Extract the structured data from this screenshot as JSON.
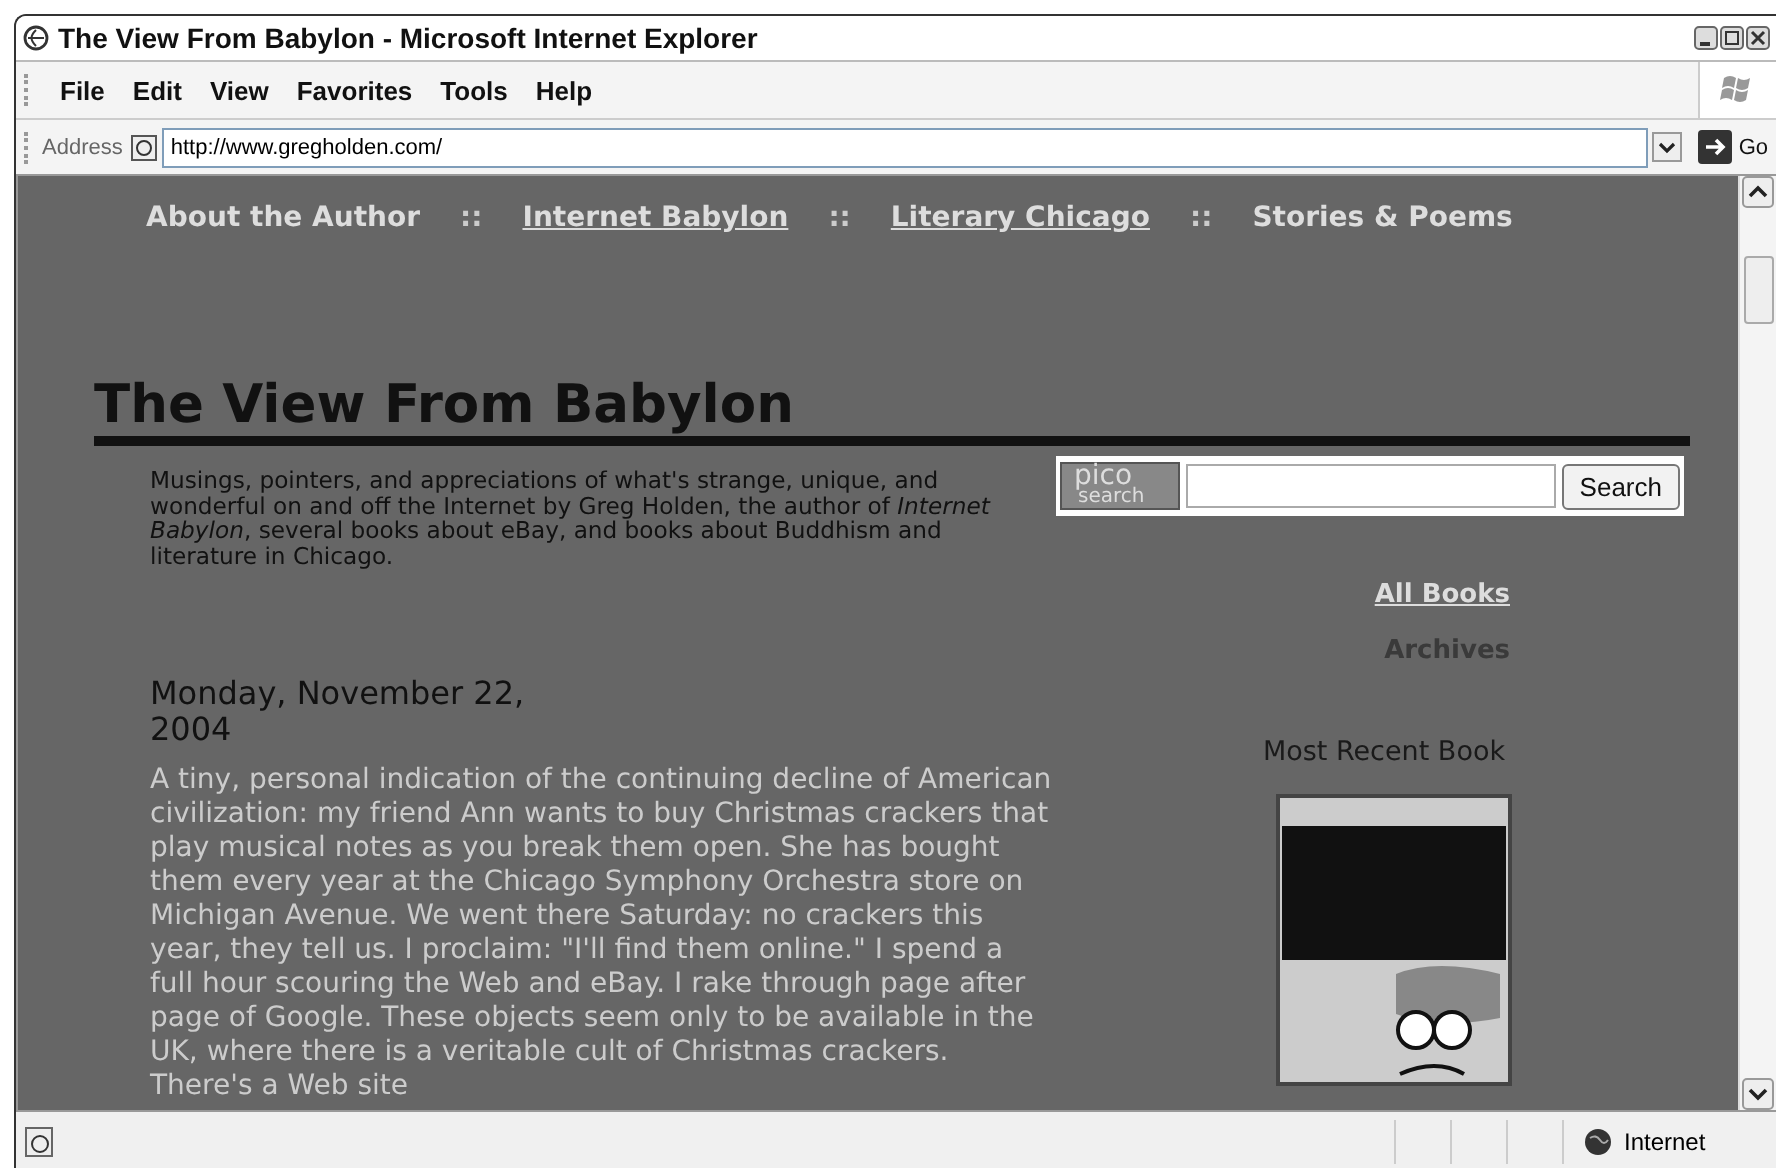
{
  "window": {
    "title": "The View From Babylon - Microsoft Internet Explorer"
  },
  "menu": [
    "File",
    "Edit",
    "View",
    "Favorites",
    "Tools",
    "Help"
  ],
  "address_bar": {
    "label": "Address",
    "url": "http://www.gregholden.com/",
    "go": "Go"
  },
  "nav": [
    {
      "label": "About the Author",
      "kind": "plain"
    },
    {
      "label": "::",
      "kind": "separator"
    },
    {
      "label": "Internet Babylon",
      "kind": "link"
    },
    {
      "label": "::",
      "kind": "separator"
    },
    {
      "label": "Literary Chicago",
      "kind": "link"
    },
    {
      "label": "::",
      "kind": "separator"
    },
    {
      "label": "Stories & Poems",
      "kind": "plain"
    }
  ],
  "heading": "The View From Babylon",
  "description": "Musings, pointers, and appreciations of what's strange, unique, and wonderful on and off the Internet by Greg Holden, the author of *Internet Babylon*, several books about eBay, and books about Buddhism and literature in Chicago.",
  "search": {
    "logo": [
      "pico",
      "search"
    ],
    "button": "Search"
  },
  "sidebar_links": [
    {
      "label": "All Books",
      "kind": "link"
    },
    {
      "label": "Archives",
      "kind": "current"
    }
  ],
  "recent_book": {
    "heading": "Most Recent Book"
  },
  "post": {
    "date": "Monday, November 22, 2004",
    "body": "A tiny, personal indication of the continuing decline of American civilization: my friend Ann wants to buy Christmas crackers that play musical notes as you break them open. She has bought them every year at the Chicago Symphony Orchestra store on Michigan Avenue. We went there Saturday: no crackers this year, they tell us. I proclaim: \"I'll find them online.\" I spend a full hour scouring the Web and eBay. I rake through page after page of Google. These objects seem only to be available in the UK, where there is a veritable cult of Christmas crackers. There's a Web site"
  },
  "status_bar": {
    "zone": "Internet"
  }
}
